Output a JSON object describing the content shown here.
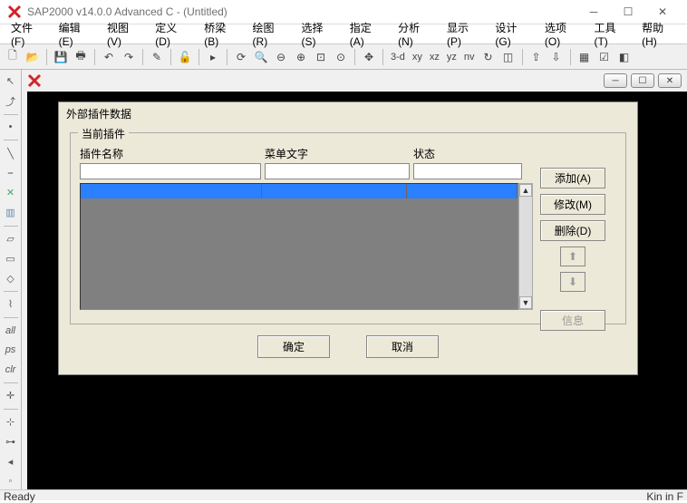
{
  "window": {
    "title": "SAP2000 v14.0.0 Advanced C  - (Untitled)"
  },
  "menu": {
    "file": "文件(F)",
    "edit": "编辑(E)",
    "view": "视图(V)",
    "define": "定义(D)",
    "bridge": "桥梁(B)",
    "draw": "绘图(R)",
    "select": "选择(S)",
    "assign": "指定(A)",
    "analyze": "分析(N)",
    "display": "显示(P)",
    "design": "设计(G)",
    "options": "选项(O)",
    "tools": "工具(T)",
    "help": "帮助(H)"
  },
  "toolbar": {
    "labels": {
      "btn3d": "3-d",
      "btnXY": "xy",
      "btnXZ": "xz",
      "btnYZ": "yz",
      "btnNV": "nv"
    }
  },
  "dialog": {
    "title": "外部插件数据",
    "groupTitle": "当前插件",
    "columns": {
      "name": "插件名称",
      "menu": "菜单文字",
      "status": "状态"
    },
    "buttons": {
      "add": "添加(A)",
      "modify": "修改(M)",
      "delete": "删除(D)",
      "info": "信息",
      "ok": "确定",
      "cancel": "取消"
    }
  },
  "status": {
    "left": "Ready",
    "right": "Kin  in  F"
  }
}
